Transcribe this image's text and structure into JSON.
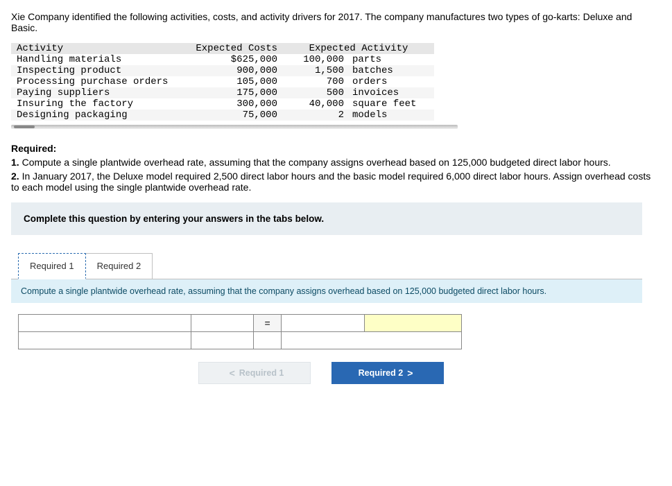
{
  "intro": "Xie Company identified the following activities, costs, and activity drivers for 2017. The company manufactures two types of go-karts: Deluxe and Basic.",
  "table": {
    "headers": {
      "activity": "Activity",
      "costs": "Expected Costs",
      "activity_driver": "Expected Activity"
    },
    "rows": [
      {
        "activity": "Handling materials",
        "cost": "$625,000",
        "act_val": "100,000",
        "act_unit": "parts"
      },
      {
        "activity": "Inspecting product",
        "cost": "900,000",
        "act_val": "1,500",
        "act_unit": "batches"
      },
      {
        "activity": "Processing purchase orders",
        "cost": "105,000",
        "act_val": "700",
        "act_unit": "orders"
      },
      {
        "activity": "Paying suppliers",
        "cost": "175,000",
        "act_val": "500",
        "act_unit": "invoices"
      },
      {
        "activity": "Insuring the factory",
        "cost": "300,000",
        "act_val": "40,000",
        "act_unit": "square feet"
      },
      {
        "activity": "Designing packaging",
        "cost": "75,000",
        "act_val": "2",
        "act_unit": "models"
      }
    ]
  },
  "required": {
    "heading": "Required:",
    "item1_prefix": "1.",
    "item1_text": " Compute a single plantwide overhead rate, assuming that the company assigns overhead based on 125,000 budgeted direct labor hours.",
    "item2_prefix": "2.",
    "item2_text": " In January 2017, the Deluxe model required 2,500 direct labor hours and the basic model required 6,000 direct labor hours. Assign overhead costs to each model using the single plantwide overhead rate."
  },
  "instruction_box": "Complete this question by entering your answers in the tabs below.",
  "tabs": {
    "t1": "Required 1",
    "t2": "Required 2"
  },
  "tab_prompt": "Compute a single plantwide overhead rate, assuming that the company assigns overhead based on 125,000 budgeted direct labor hours.",
  "eq_sign": "=",
  "nav": {
    "prev": "Required 1",
    "next": "Required 2",
    "chev_left": "<",
    "chev_right": ">"
  }
}
